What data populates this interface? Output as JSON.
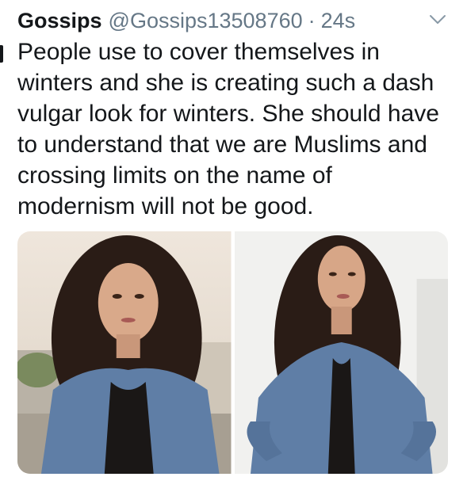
{
  "tweet": {
    "author_name": "Gossips",
    "handle": "@Gossips13508760",
    "separator": "·",
    "timestamp": "24s",
    "menu_icon": "chevron-down-icon",
    "text_lines": [
      "People use to cover themselves in",
      "winters and she is creating such a dash",
      "vulgar look for winters. She should have",
      "to understand that we are Muslims and",
      "crossing limits on the name of",
      "modernism will not be good."
    ]
  },
  "colors": {
    "text": "#14171a",
    "secondary": "#657786",
    "denim": "#5f7ea6",
    "hair": "#2a1c16"
  },
  "media": {
    "photos": [
      "photo-woman-denim-jacket-outdoor",
      "photo-woman-denim-jacket-white-wall"
    ]
  }
}
